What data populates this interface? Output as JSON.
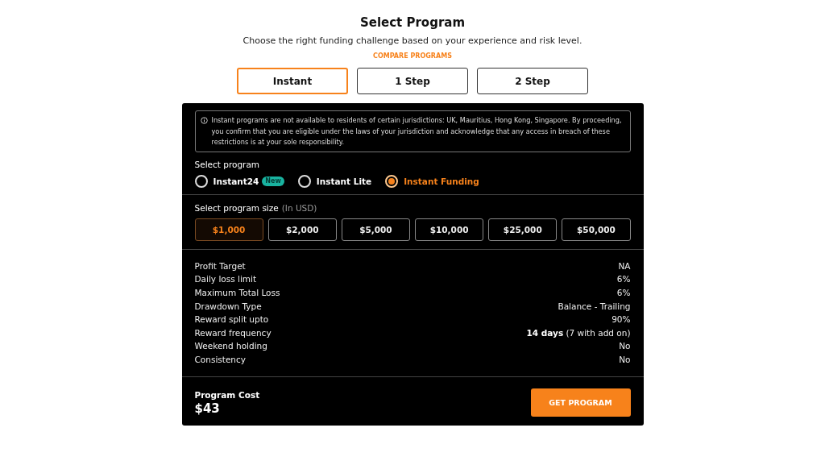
{
  "header": {
    "title": "Select Program",
    "subtitle": "Choose the right funding challenge based on your experience and risk level.",
    "link": "COMPARE PROGRAMS"
  },
  "tabs": [
    {
      "label": "Instant",
      "selected": true
    },
    {
      "label": "1 Step",
      "selected": false
    },
    {
      "label": "2 Step",
      "selected": false
    }
  ],
  "notice": "Instant programs are not available to residents of certain jurisdictions: UK, Mauritius, Hong Kong, Singapore. By proceeding, you confirm that you are eligible under the laws of your jurisdiction and acknowledge that any access in breach of these restrictions is at your sole responsibility.",
  "program": {
    "label": "Select program",
    "options": [
      {
        "label": "Instant24",
        "badge": "New",
        "selected": false
      },
      {
        "label": "Instant Lite",
        "selected": false
      },
      {
        "label": "Instant Funding",
        "selected": true
      }
    ]
  },
  "size": {
    "label": "Select program size",
    "note": "(In USD)",
    "options": [
      {
        "label": "$1,000",
        "selected": true
      },
      {
        "label": "$2,000",
        "selected": false
      },
      {
        "label": "$5,000",
        "selected": false
      },
      {
        "label": "$10,000",
        "selected": false
      },
      {
        "label": "$25,000",
        "selected": false
      },
      {
        "label": "$50,000",
        "selected": false
      }
    ]
  },
  "details": [
    {
      "label": "Profit Target",
      "value": "NA"
    },
    {
      "label": "Daily loss limit",
      "value": "6%"
    },
    {
      "label": "Maximum Total Loss",
      "value": "6%"
    },
    {
      "label": "Drawdown Type",
      "value": "Balance - Trailing"
    },
    {
      "label": "Reward split upto",
      "value": "90%"
    },
    {
      "label": "Reward frequency",
      "value": "**14 days** (7 with add on)"
    },
    {
      "label": "Weekend holding",
      "value": "No"
    },
    {
      "label": "Consistency",
      "value": "No"
    }
  ],
  "cost": {
    "label": "Program Cost",
    "value": "$43",
    "button": "GET PROGRAM"
  }
}
